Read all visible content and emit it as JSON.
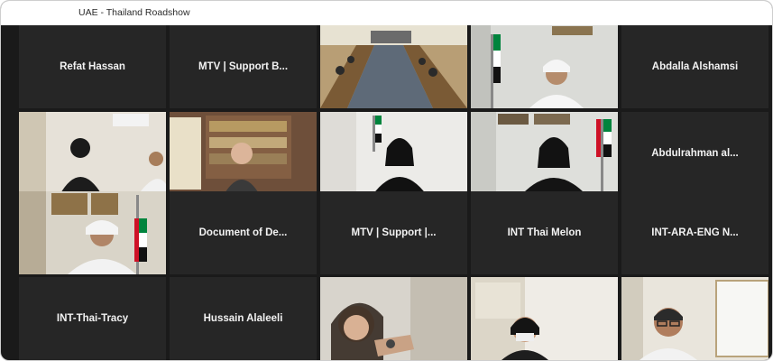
{
  "window": {
    "title": "UAE - Thailand Roadshow"
  },
  "participants": [
    {
      "name": "Refat Hassan"
    },
    {
      "name": "MTV | Support B..."
    },
    {
      "name": "Abdalla Alshamsi"
    },
    {
      "name": "Abdulrahman  al..."
    },
    {
      "name": "Document  of  De..."
    },
    {
      "name": "MTV | Support |..."
    },
    {
      "name": "INT Thai Melon"
    },
    {
      "name": "INT-ARA-ENG  N..."
    },
    {
      "name": "INT-Thai-Tracy"
    },
    {
      "name": "Hussain Alaleeli"
    }
  ],
  "colors": {
    "tile_bg": "#262626",
    "active_speaker_border": "#e8e66a"
  }
}
